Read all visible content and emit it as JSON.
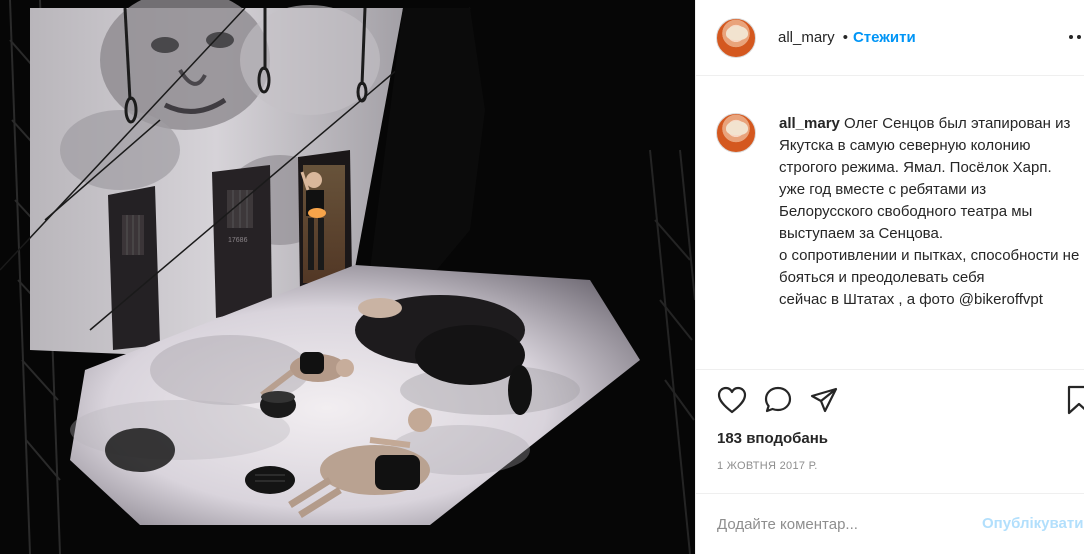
{
  "post": {
    "author": "all_mary",
    "separator": "•",
    "follow_label": "Стежити",
    "caption_user": "all_mary",
    "caption_text": " Олег Сенцов был этапирован из Якутска в самую северную колонию строгого режима. Ямал. Посёлок Харп.\nуже год вместе с ребятами из Белорусского свободного театра мы выступаем за Сенцова.\nо сопротивлении и пытках, способности не бояться и преодолевать себя\nсейчас в Штатах , а фото @bikeroffvpt",
    "likes": "183 вподобань",
    "date": "1 ЖОВТНЯ 2017 Р.",
    "comment_placeholder": "Додайте коментар...",
    "publish_label": "Опублікувати"
  },
  "photo": {
    "door_label": "17686"
  },
  "icons": {
    "like": "heart-icon",
    "comment": "comment-icon",
    "share": "share-icon",
    "save": "bookmark-icon",
    "more": "more-icon"
  },
  "colors": {
    "accent": "#0095f6",
    "publish_disabled": "#b2dffc",
    "muted": "#8e8e8e",
    "text": "#262626",
    "border": "#efefef"
  }
}
